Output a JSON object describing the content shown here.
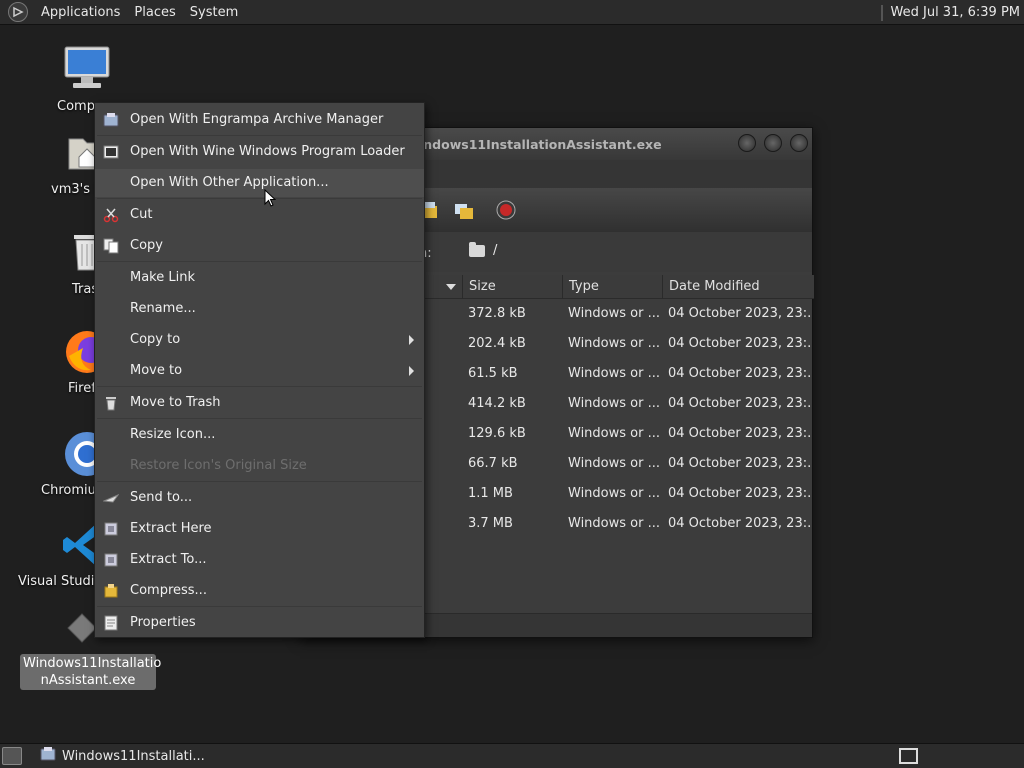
{
  "top_panel": {
    "menus": [
      "Applications",
      "Places",
      "System"
    ],
    "clock": "Wed Jul 31,  6:39 PM"
  },
  "desktop_icons": [
    {
      "label": "Comp",
      "icon": "computer-icon"
    },
    {
      "label": "vm3's H",
      "icon": "home-folder-icon"
    },
    {
      "label": "Tras",
      "icon": "trash-icon"
    },
    {
      "label": "Firef",
      "icon": "firefox-icon"
    },
    {
      "label": "Chromiu",
      "icon": "chromium-icon"
    },
    {
      "label": "Visual Studio",
      "icon": "vscode-icon"
    },
    {
      "label": "Windows11InstallationAssistant.exe",
      "line1": "Windows11Installatio",
      "line2": "nAssistant.exe",
      "icon": "exe-file-icon"
    }
  ],
  "file_manager": {
    "title": "indows11InstallationAssistant.exe",
    "location_label": "on:",
    "location_path": "/",
    "columns": [
      "Size",
      "Type",
      "Date Modified"
    ],
    "rows": [
      {
        "size": "372.8 kB",
        "type": "Windows or ...",
        "date": "04 October 2023, 23:..."
      },
      {
        "size": "202.4 kB",
        "type": "Windows or ...",
        "date": "04 October 2023, 23:..."
      },
      {
        "size": "61.5 kB",
        "type": "Windows or ...",
        "date": "04 October 2023, 23:..."
      },
      {
        "size": "414.2 kB",
        "type": "Windows or ...",
        "date": "04 October 2023, 23:..."
      },
      {
        "size": "129.6 kB",
        "type": "Windows or ...",
        "date": "04 October 2023, 23:..."
      },
      {
        "size": "66.7 kB",
        "type": "Windows or ...",
        "date": "04 October 2023, 23:..."
      },
      {
        "size": "1.1 MB",
        "type": "Windows or ...",
        "date": "04 October 2023, 23:..."
      },
      {
        "size": "3.7 MB",
        "type": "Windows or ...",
        "date": "04 October 2023, 23:..."
      }
    ]
  },
  "context_menu": {
    "items": [
      {
        "label": "Open With Engrampa Archive Manager",
        "icon": "archive-manager-icon"
      },
      {
        "label": "Open With Wine Windows Program Loader",
        "icon": "wine-icon"
      },
      {
        "label": "Open With Other Application...",
        "icon": ""
      },
      {
        "label": "Cut",
        "icon": "scissors-icon"
      },
      {
        "label": "Copy",
        "icon": "copy-icon"
      },
      {
        "label": "Make Link",
        "icon": ""
      },
      {
        "label": "Rename...",
        "icon": ""
      },
      {
        "label": "Copy to",
        "icon": ""
      },
      {
        "label": "Move to",
        "icon": ""
      },
      {
        "label": "Move to Trash",
        "icon": "trash-icon"
      },
      {
        "label": "Resize Icon...",
        "icon": ""
      },
      {
        "label": "Restore Icon's Original Size",
        "icon": "",
        "disabled": true
      },
      {
        "label": "Send to...",
        "icon": "send-icon"
      },
      {
        "label": "Extract Here",
        "icon": "extract-icon"
      },
      {
        "label": "Extract To...",
        "icon": "extract-icon"
      },
      {
        "label": "Compress...",
        "icon": "compress-icon"
      },
      {
        "label": "Properties",
        "icon": "properties-icon"
      }
    ]
  },
  "taskbar": {
    "window_button": "Windows11Installati..."
  },
  "colors": {
    "panel": "#2b2b2b",
    "menu_bg": "#444444",
    "desktop": "#1f1f1f",
    "accent_red": "#c62828"
  }
}
